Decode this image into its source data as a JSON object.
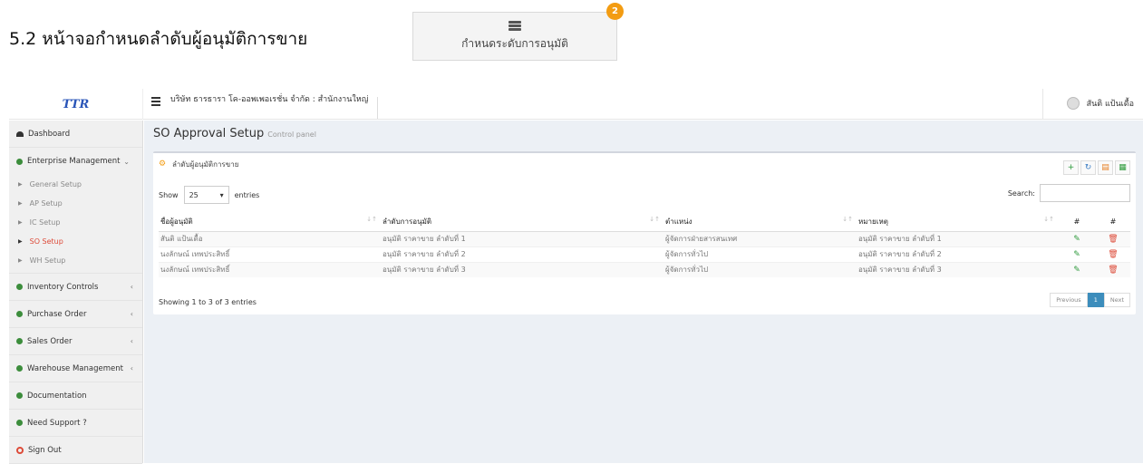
{
  "doc": {
    "heading": "5.2 หน้าจอกำหนดลำดับผู้อนุมัติการขาย",
    "callout_label": "กำหนดระดับการอนุมัติ",
    "callout_badge": "2"
  },
  "topbar": {
    "logo": "TTR",
    "company": "บริษัท ธารธารา โค-ออพเพอเรชั่น จำกัด : สำนักงานใหญ่",
    "user_name": "สันติ แป้นเดื้อ"
  },
  "sidebar": {
    "dashboard": "Dashboard",
    "enterprise": "Enterprise Management",
    "sub_items": [
      "General Setup",
      "AP Setup",
      "IC Setup",
      "SO Setup",
      "WH Setup"
    ],
    "inventory": "Inventory Controls",
    "purchase": "Purchase Order",
    "sales": "Sales Order",
    "warehouse": "Warehouse Management",
    "documentation": "Documentation",
    "support": "Need Support ?",
    "signout": "Sign Out"
  },
  "content": {
    "title": "SO Approval Setup",
    "subtitle": "Control panel",
    "box_title": "ลำดับผู้อนุมัติการขาย",
    "show_label": "Show",
    "show_value": "25",
    "entries_label": "entries",
    "search_label": "Search:",
    "columns": [
      "ชื่อผู้อนุมัติ",
      "ลำดับการอนุมัติ",
      "ตำแหน่ง",
      "หมายเหตุ",
      "#",
      "#"
    ],
    "rows": [
      [
        "สันติ แป้นเดื้อ",
        "อนุมัติ ราคาขาย ลำดับที่ 1",
        "ผู้จัดการฝ่ายสารสนเทศ",
        "อนุมัติ ราคาขาย ลำดับที่ 1"
      ],
      [
        "นงลักษณ์ เทพประสิทธิ์",
        "อนุมัติ ราคาขาย ลำดับที่ 2",
        "ผู้จัดการทั่วไป",
        "อนุมัติ ราคาขาย ลำดับที่ 2"
      ],
      [
        "นงลักษณ์ เทพประสิทธิ์",
        "อนุมัติ ราคาขาย ลำดับที่ 3",
        "ผู้จัดการทั่วไป",
        "อนุมัติ ราคาขาย ลำดับที่ 3"
      ]
    ],
    "info": "Showing 1 to 3 of 3 entries",
    "pager": {
      "prev": "Previous",
      "page": "1",
      "next": "Next"
    }
  }
}
